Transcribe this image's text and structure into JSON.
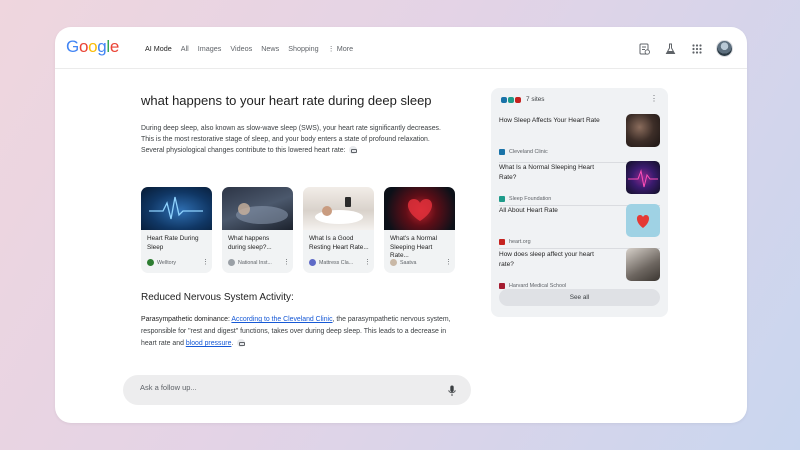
{
  "header": {
    "logo": "Google",
    "tabs": [
      {
        "label": "AI Mode"
      },
      {
        "label": "All"
      },
      {
        "label": "Images"
      },
      {
        "label": "Videos"
      },
      {
        "label": "News"
      },
      {
        "label": "Shopping"
      },
      {
        "label": "⋮ More"
      }
    ],
    "icons": [
      "history-icon",
      "labs-icon",
      "apps-grid-icon",
      "avatar"
    ]
  },
  "main": {
    "query": "what happens to your heart rate during deep sleep",
    "intro": "During deep sleep, also known as slow-wave sleep (SWS), your heart rate significantly decreases. This is the most restorative stage of sleep, and your body enters a state of profound relaxation. Several physiological changes contribute to this lowered heart rate:",
    "cards": [
      {
        "title": "Heart Rate During Sleep",
        "source": "Welltory",
        "fav_color": "#2e7d32"
      },
      {
        "title": "What happens during sleep?...",
        "source": "National Inst...",
        "fav_color": "#9aa0a6"
      },
      {
        "title": "What Is a Good Resting Heart Rate...",
        "source": "Mattress Cla...",
        "fav_color": "#5e6ac7"
      },
      {
        "title": "What's a Normal Sleeping Heart Rate...",
        "source": "Saatva",
        "fav_color": "#c9b8a6"
      }
    ],
    "section_heading": "Reduced Nervous System Activity:",
    "para": {
      "lead": "Parasympathetic dominance:",
      "link1": "According to the Cleveland Clinic",
      "middle": ", the parasympathetic nervous system, responsible for \"rest and digest\" functions, takes over during deep sleep. This leads to a decrease in heart rate and",
      "link2": "blood pressure",
      "end": "."
    },
    "followup_placeholder": "Ask a follow up..."
  },
  "sources": {
    "count_label": "7 sites",
    "items": [
      {
        "title": "How Sleep Affects Your Heart Rate",
        "site": "Cleveland Clinic",
        "fav_color": "#1a73a8"
      },
      {
        "title": "What Is a Normal Sleeping Heart Rate?",
        "site": "Sleep Foundation",
        "fav_color": "#1e9b8a"
      },
      {
        "title": "All About Heart Rate",
        "site": "heart.org",
        "fav_color": "#c5221f"
      },
      {
        "title": "How does sleep affect your heart rate?",
        "site": "Harvard Medical School",
        "fav_color": "#a51c30"
      }
    ],
    "see_all": "See all"
  }
}
